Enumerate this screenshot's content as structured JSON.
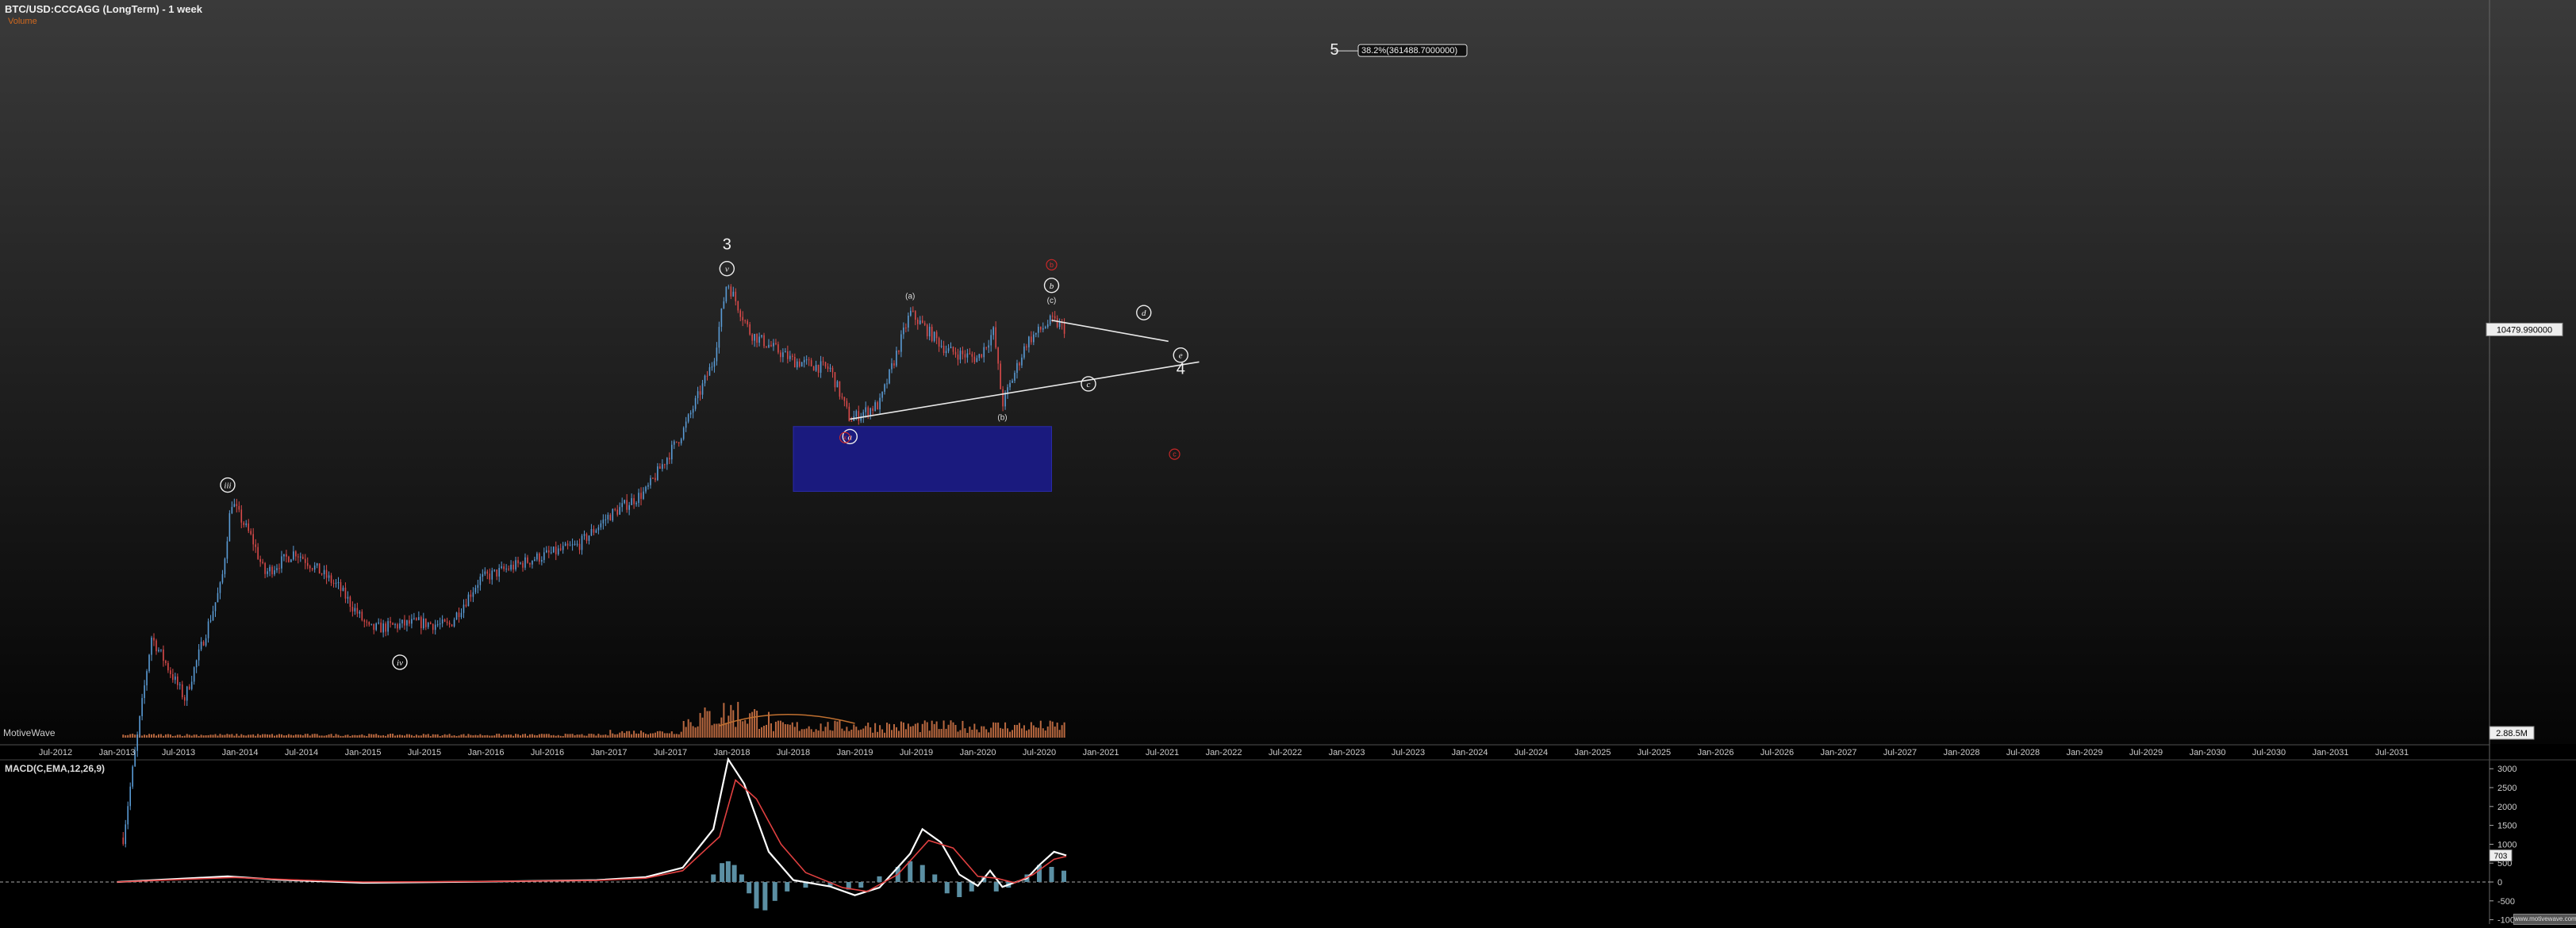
{
  "header": {
    "title": "BTC/USD:CCCAGG (LongTerm) - 1 week",
    "volume_label": "Volume",
    "watermark": "MotiveWave",
    "macd_title": "MACD(C,EMA,12,26,9)",
    "credit": "www.motivewave.com"
  },
  "colors": {
    "up_candle": "#5a9bd5",
    "down_candle": "#d94a4a",
    "volume_bar": "#d97a4a",
    "zone_fill": "#1a1a7e",
    "macd_line": "#ffffff",
    "signal_line": "#e04040",
    "histogram": "#5b8fa3",
    "last_price_tag": "#eeeeee"
  },
  "chart_data": [
    {
      "type": "candlestick",
      "title": "BTC/USD:CCCAGG (LongTerm) - 1 week",
      "scale": "log",
      "x_tick_labels": [
        "Jul-2012",
        "Jan-2013",
        "Jul-2013",
        "Jan-2014",
        "Jul-2014",
        "Jan-2015",
        "Jul-2015",
        "Jan-2016",
        "Jul-2016",
        "Jan-2017",
        "Jul-2017",
        "Jan-2018",
        "Jul-2018",
        "Jan-2019",
        "Jul-2019",
        "Jan-2020",
        "Jul-2020",
        "Jan-2021",
        "Jul-2021",
        "Jan-2022",
        "Jul-2022",
        "Jan-2023",
        "Jul-2023",
        "Jan-2024",
        "Jul-2024",
        "Jan-2025",
        "Jul-2025",
        "Jan-2026",
        "Jul-2026",
        "Jan-2027",
        "Jul-2027",
        "Jan-2028",
        "Jul-2028",
        "Jan-2029",
        "Jul-2029",
        "Jan-2030",
        "Jul-2030",
        "Jan-2031",
        "Jul-2031"
      ],
      "x_range": [
        "2012.25",
        "2031.75"
      ],
      "price_path": [
        {
          "date": 2013.05,
          "price": 15
        },
        {
          "date": 2013.28,
          "price": 200
        },
        {
          "date": 2013.55,
          "price": 90
        },
        {
          "date": 2013.85,
          "price": 400
        },
        {
          "date": 2013.93,
          "price": 1150
        },
        {
          "date": 2014.1,
          "price": 700
        },
        {
          "date": 2014.2,
          "price": 450
        },
        {
          "date": 2014.45,
          "price": 600
        },
        {
          "date": 2014.8,
          "price": 380
        },
        {
          "date": 2015.05,
          "price": 220
        },
        {
          "date": 2015.45,
          "price": 240
        },
        {
          "date": 2015.7,
          "price": 230
        },
        {
          "date": 2015.95,
          "price": 420
        },
        {
          "date": 2016.4,
          "price": 550
        },
        {
          "date": 2016.75,
          "price": 650
        },
        {
          "date": 2017.0,
          "price": 950
        },
        {
          "date": 2017.3,
          "price": 1300
        },
        {
          "date": 2017.6,
          "price": 2800
        },
        {
          "date": 2017.85,
          "price": 7000
        },
        {
          "date": 2017.96,
          "price": 19500
        },
        {
          "date": 2018.15,
          "price": 10000
        },
        {
          "date": 2018.5,
          "price": 7000
        },
        {
          "date": 2018.8,
          "price": 6300
        },
        {
          "date": 2018.96,
          "price": 3300
        },
        {
          "date": 2019.2,
          "price": 4000
        },
        {
          "date": 2019.45,
          "price": 13000
        },
        {
          "date": 2019.75,
          "price": 8000
        },
        {
          "date": 2020.0,
          "price": 7200
        },
        {
          "date": 2020.13,
          "price": 10300
        },
        {
          "date": 2020.2,
          "price": 4000
        },
        {
          "date": 2020.4,
          "price": 9000
        },
        {
          "date": 2020.6,
          "price": 11800
        },
        {
          "date": 2020.72,
          "price": 10480
        }
      ],
      "last_price_label": "10479.990000",
      "volume_label": "2.88.5M",
      "wave_labels": [
        {
          "text": "iii",
          "date": 2013.9,
          "price": 1150,
          "style": "circle"
        },
        {
          "text": "iv",
          "date": 2015.3,
          "price": 180,
          "style": "circle"
        },
        {
          "text": "3",
          "date": 2017.96,
          "price": 19500,
          "style": "big"
        },
        {
          "text": "v",
          "date": 2017.96,
          "price": 19500,
          "style": "circle"
        },
        {
          "text": "a",
          "date": 2018.96,
          "price": 3300,
          "style": "circle"
        },
        {
          "text": "(a)",
          "date": 2019.45,
          "price": 13000,
          "style": "small"
        },
        {
          "text": "(b)",
          "date": 2020.2,
          "price": 4000,
          "style": "small"
        },
        {
          "text": "(c)",
          "date": 2020.6,
          "price": 11800,
          "style": "small"
        },
        {
          "text": "b",
          "date": 2020.6,
          "price": 11800,
          "style": "circle"
        },
        {
          "text": "c",
          "date": 2020.9,
          "price": 5200,
          "style": "circle"
        },
        {
          "text": "d",
          "date": 2021.35,
          "price": 12500,
          "style": "circle"
        },
        {
          "text": "e",
          "date": 2021.65,
          "price": 6800,
          "style": "circle"
        },
        {
          "text": "4",
          "date": 2021.65,
          "price": 6800,
          "style": "big"
        },
        {
          "text": "5",
          "date": 2022.9,
          "price": 361488,
          "style": "big"
        },
        {
          "text": "x",
          "date": 2018.92,
          "price": 2600,
          "style": "red"
        },
        {
          "text": "b",
          "date": 2020.6,
          "price": 11800,
          "style": "red"
        },
        {
          "text": "c",
          "date": 2021.6,
          "price": 2100,
          "style": "red"
        }
      ],
      "annotation": "38.2%(361488.7000000)",
      "trendlines": [
        {
          "from": {
            "date": 2018.96,
            "price": 3300
          },
          "to": {
            "date": 2021.8,
            "price": 6900
          }
        },
        {
          "from": {
            "date": 2020.6,
            "price": 11800
          },
          "to": {
            "date": 2021.55,
            "price": 9000
          }
        }
      ],
      "zone": {
        "from_date": 2018.5,
        "to_date": 2020.6,
        "price_high": 3000,
        "price_low": 1300
      }
    },
    {
      "type": "line",
      "title": "MACD(C,EMA,12,26,9)",
      "ylim": [
        -1000,
        3500
      ],
      "y_ticks": [
        3000,
        2500,
        2000,
        1500,
        1000,
        500,
        0,
        -500,
        -1000
      ],
      "last_value_label": "703",
      "series": [
        {
          "name": "MACD",
          "points": [
            [
              2013.0,
              0
            ],
            [
              2013.9,
              150
            ],
            [
              2014.3,
              60
            ],
            [
              2015.0,
              -20
            ],
            [
              2016.0,
              10
            ],
            [
              2016.9,
              50
            ],
            [
              2017.3,
              130
            ],
            [
              2017.6,
              380
            ],
            [
              2017.85,
              1400
            ],
            [
              2017.97,
              3250
            ],
            [
              2018.1,
              2600
            ],
            [
              2018.3,
              800
            ],
            [
              2018.5,
              50
            ],
            [
              2018.8,
              -120
            ],
            [
              2019.0,
              -350
            ],
            [
              2019.2,
              -150
            ],
            [
              2019.45,
              750
            ],
            [
              2019.55,
              1400
            ],
            [
              2019.7,
              1050
            ],
            [
              2019.85,
              200
            ],
            [
              2020.0,
              -100
            ],
            [
              2020.1,
              300
            ],
            [
              2020.2,
              -130
            ],
            [
              2020.4,
              100
            ],
            [
              2020.5,
              450
            ],
            [
              2020.62,
              800
            ],
            [
              2020.72,
              703
            ]
          ]
        },
        {
          "name": "Signal",
          "points": [
            [
              2013.0,
              0
            ],
            [
              2013.95,
              120
            ],
            [
              2014.4,
              60
            ],
            [
              2015.0,
              0
            ],
            [
              2016.0,
              15
            ],
            [
              2016.9,
              40
            ],
            [
              2017.3,
              100
            ],
            [
              2017.6,
              300
            ],
            [
              2017.9,
              1200
            ],
            [
              2018.03,
              2700
            ],
            [
              2018.2,
              2200
            ],
            [
              2018.4,
              1000
            ],
            [
              2018.6,
              250
            ],
            [
              2018.9,
              -150
            ],
            [
              2019.1,
              -250
            ],
            [
              2019.35,
              200
            ],
            [
              2019.6,
              1100
            ],
            [
              2019.8,
              900
            ],
            [
              2020.0,
              150
            ],
            [
              2020.15,
              100
            ],
            [
              2020.3,
              -20
            ],
            [
              2020.45,
              200
            ],
            [
              2020.62,
              600
            ],
            [
              2020.72,
              680
            ]
          ]
        }
      ],
      "histogram": [
        [
          2017.85,
          200
        ],
        [
          2017.92,
          500
        ],
        [
          2017.97,
          550
        ],
        [
          2018.02,
          450
        ],
        [
          2018.08,
          200
        ],
        [
          2018.14,
          -300
        ],
        [
          2018.2,
          -700
        ],
        [
          2018.27,
          -750
        ],
        [
          2018.35,
          -500
        ],
        [
          2018.45,
          -250
        ],
        [
          2018.6,
          -150
        ],
        [
          2018.8,
          -100
        ],
        [
          2018.95,
          -200
        ],
        [
          2019.05,
          -150
        ],
        [
          2019.2,
          150
        ],
        [
          2019.35,
          400
        ],
        [
          2019.45,
          550
        ],
        [
          2019.55,
          450
        ],
        [
          2019.65,
          200
        ],
        [
          2019.75,
          -300
        ],
        [
          2019.85,
          -400
        ],
        [
          2019.95,
          -250
        ],
        [
          2020.05,
          150
        ],
        [
          2020.15,
          -250
        ],
        [
          2020.25,
          -150
        ],
        [
          2020.4,
          200
        ],
        [
          2020.5,
          450
        ],
        [
          2020.6,
          400
        ],
        [
          2020.7,
          300
        ]
      ]
    }
  ]
}
